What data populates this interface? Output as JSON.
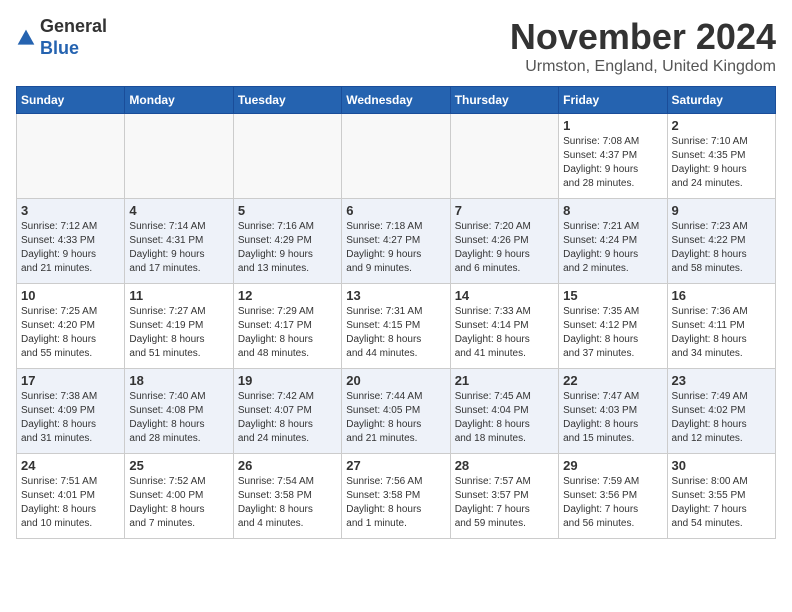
{
  "logo": {
    "line1": "General",
    "line2": "Blue"
  },
  "title": "November 2024",
  "location": "Urmston, England, United Kingdom",
  "headers": [
    "Sunday",
    "Monday",
    "Tuesday",
    "Wednesday",
    "Thursday",
    "Friday",
    "Saturday"
  ],
  "weeks": [
    {
      "alt": false,
      "days": [
        {
          "num": "",
          "info": ""
        },
        {
          "num": "",
          "info": ""
        },
        {
          "num": "",
          "info": ""
        },
        {
          "num": "",
          "info": ""
        },
        {
          "num": "",
          "info": ""
        },
        {
          "num": "1",
          "info": "Sunrise: 7:08 AM\nSunset: 4:37 PM\nDaylight: 9 hours\nand 28 minutes."
        },
        {
          "num": "2",
          "info": "Sunrise: 7:10 AM\nSunset: 4:35 PM\nDaylight: 9 hours\nand 24 minutes."
        }
      ]
    },
    {
      "alt": true,
      "days": [
        {
          "num": "3",
          "info": "Sunrise: 7:12 AM\nSunset: 4:33 PM\nDaylight: 9 hours\nand 21 minutes."
        },
        {
          "num": "4",
          "info": "Sunrise: 7:14 AM\nSunset: 4:31 PM\nDaylight: 9 hours\nand 17 minutes."
        },
        {
          "num": "5",
          "info": "Sunrise: 7:16 AM\nSunset: 4:29 PM\nDaylight: 9 hours\nand 13 minutes."
        },
        {
          "num": "6",
          "info": "Sunrise: 7:18 AM\nSunset: 4:27 PM\nDaylight: 9 hours\nand 9 minutes."
        },
        {
          "num": "7",
          "info": "Sunrise: 7:20 AM\nSunset: 4:26 PM\nDaylight: 9 hours\nand 6 minutes."
        },
        {
          "num": "8",
          "info": "Sunrise: 7:21 AM\nSunset: 4:24 PM\nDaylight: 9 hours\nand 2 minutes."
        },
        {
          "num": "9",
          "info": "Sunrise: 7:23 AM\nSunset: 4:22 PM\nDaylight: 8 hours\nand 58 minutes."
        }
      ]
    },
    {
      "alt": false,
      "days": [
        {
          "num": "10",
          "info": "Sunrise: 7:25 AM\nSunset: 4:20 PM\nDaylight: 8 hours\nand 55 minutes."
        },
        {
          "num": "11",
          "info": "Sunrise: 7:27 AM\nSunset: 4:19 PM\nDaylight: 8 hours\nand 51 minutes."
        },
        {
          "num": "12",
          "info": "Sunrise: 7:29 AM\nSunset: 4:17 PM\nDaylight: 8 hours\nand 48 minutes."
        },
        {
          "num": "13",
          "info": "Sunrise: 7:31 AM\nSunset: 4:15 PM\nDaylight: 8 hours\nand 44 minutes."
        },
        {
          "num": "14",
          "info": "Sunrise: 7:33 AM\nSunset: 4:14 PM\nDaylight: 8 hours\nand 41 minutes."
        },
        {
          "num": "15",
          "info": "Sunrise: 7:35 AM\nSunset: 4:12 PM\nDaylight: 8 hours\nand 37 minutes."
        },
        {
          "num": "16",
          "info": "Sunrise: 7:36 AM\nSunset: 4:11 PM\nDaylight: 8 hours\nand 34 minutes."
        }
      ]
    },
    {
      "alt": true,
      "days": [
        {
          "num": "17",
          "info": "Sunrise: 7:38 AM\nSunset: 4:09 PM\nDaylight: 8 hours\nand 31 minutes."
        },
        {
          "num": "18",
          "info": "Sunrise: 7:40 AM\nSunset: 4:08 PM\nDaylight: 8 hours\nand 28 minutes."
        },
        {
          "num": "19",
          "info": "Sunrise: 7:42 AM\nSunset: 4:07 PM\nDaylight: 8 hours\nand 24 minutes."
        },
        {
          "num": "20",
          "info": "Sunrise: 7:44 AM\nSunset: 4:05 PM\nDaylight: 8 hours\nand 21 minutes."
        },
        {
          "num": "21",
          "info": "Sunrise: 7:45 AM\nSunset: 4:04 PM\nDaylight: 8 hours\nand 18 minutes."
        },
        {
          "num": "22",
          "info": "Sunrise: 7:47 AM\nSunset: 4:03 PM\nDaylight: 8 hours\nand 15 minutes."
        },
        {
          "num": "23",
          "info": "Sunrise: 7:49 AM\nSunset: 4:02 PM\nDaylight: 8 hours\nand 12 minutes."
        }
      ]
    },
    {
      "alt": false,
      "days": [
        {
          "num": "24",
          "info": "Sunrise: 7:51 AM\nSunset: 4:01 PM\nDaylight: 8 hours\nand 10 minutes."
        },
        {
          "num": "25",
          "info": "Sunrise: 7:52 AM\nSunset: 4:00 PM\nDaylight: 8 hours\nand 7 minutes."
        },
        {
          "num": "26",
          "info": "Sunrise: 7:54 AM\nSunset: 3:58 PM\nDaylight: 8 hours\nand 4 minutes."
        },
        {
          "num": "27",
          "info": "Sunrise: 7:56 AM\nSunset: 3:58 PM\nDaylight: 8 hours\nand 1 minute."
        },
        {
          "num": "28",
          "info": "Sunrise: 7:57 AM\nSunset: 3:57 PM\nDaylight: 7 hours\nand 59 minutes."
        },
        {
          "num": "29",
          "info": "Sunrise: 7:59 AM\nSunset: 3:56 PM\nDaylight: 7 hours\nand 56 minutes."
        },
        {
          "num": "30",
          "info": "Sunrise: 8:00 AM\nSunset: 3:55 PM\nDaylight: 7 hours\nand 54 minutes."
        }
      ]
    }
  ]
}
